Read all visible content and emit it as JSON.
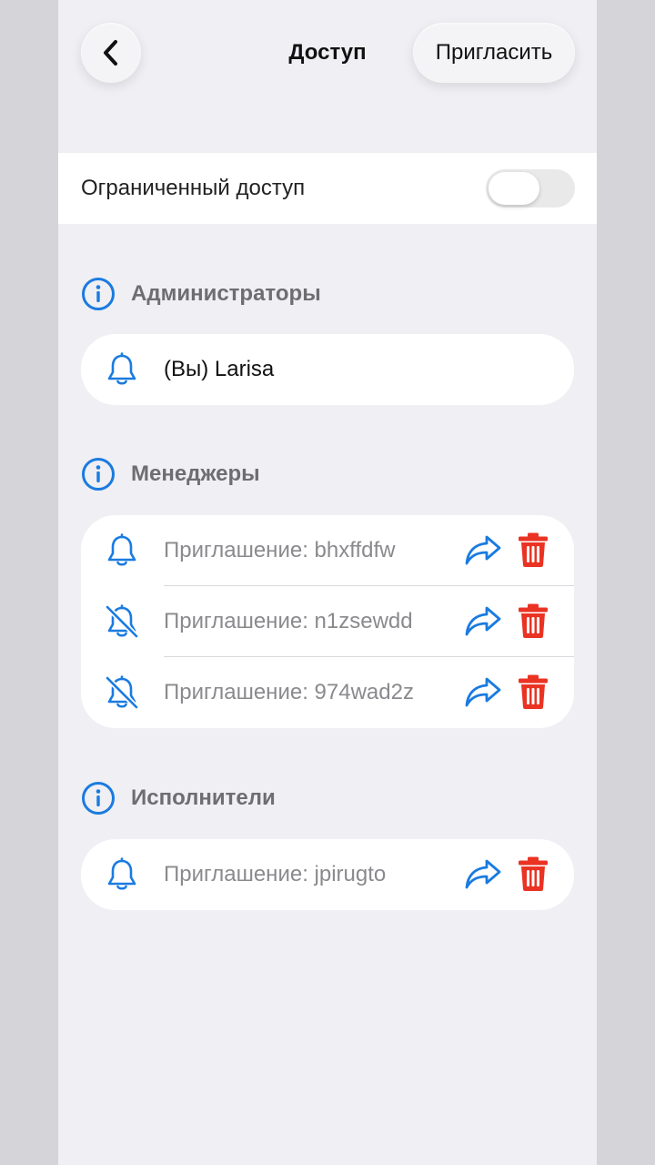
{
  "nav": {
    "title": "Доступ",
    "invite_label": "Пригласить",
    "back_icon": "chevron-left-icon"
  },
  "restricted": {
    "label": "Ограниченный доступ",
    "enabled": false
  },
  "colors": {
    "accent": "#1a7be0",
    "danger": "#ea3323",
    "muted": "#8a8a8e"
  },
  "sections": {
    "admins": {
      "title": "Администраторы",
      "items": [
        {
          "label": "(Вы) Larisa",
          "notifications": true
        }
      ]
    },
    "managers": {
      "title": "Менеджеры",
      "items": [
        {
          "label": "Приглашение: bhxffdfw",
          "notifications": true
        },
        {
          "label": "Приглашение: n1zsewdd",
          "notifications": false
        },
        {
          "label": "Приглашение: 974wad2z",
          "notifications": false
        }
      ]
    },
    "executors": {
      "title": "Исполнители",
      "items": [
        {
          "label": "Приглашение: jpirugto",
          "notifications": true
        }
      ]
    }
  }
}
